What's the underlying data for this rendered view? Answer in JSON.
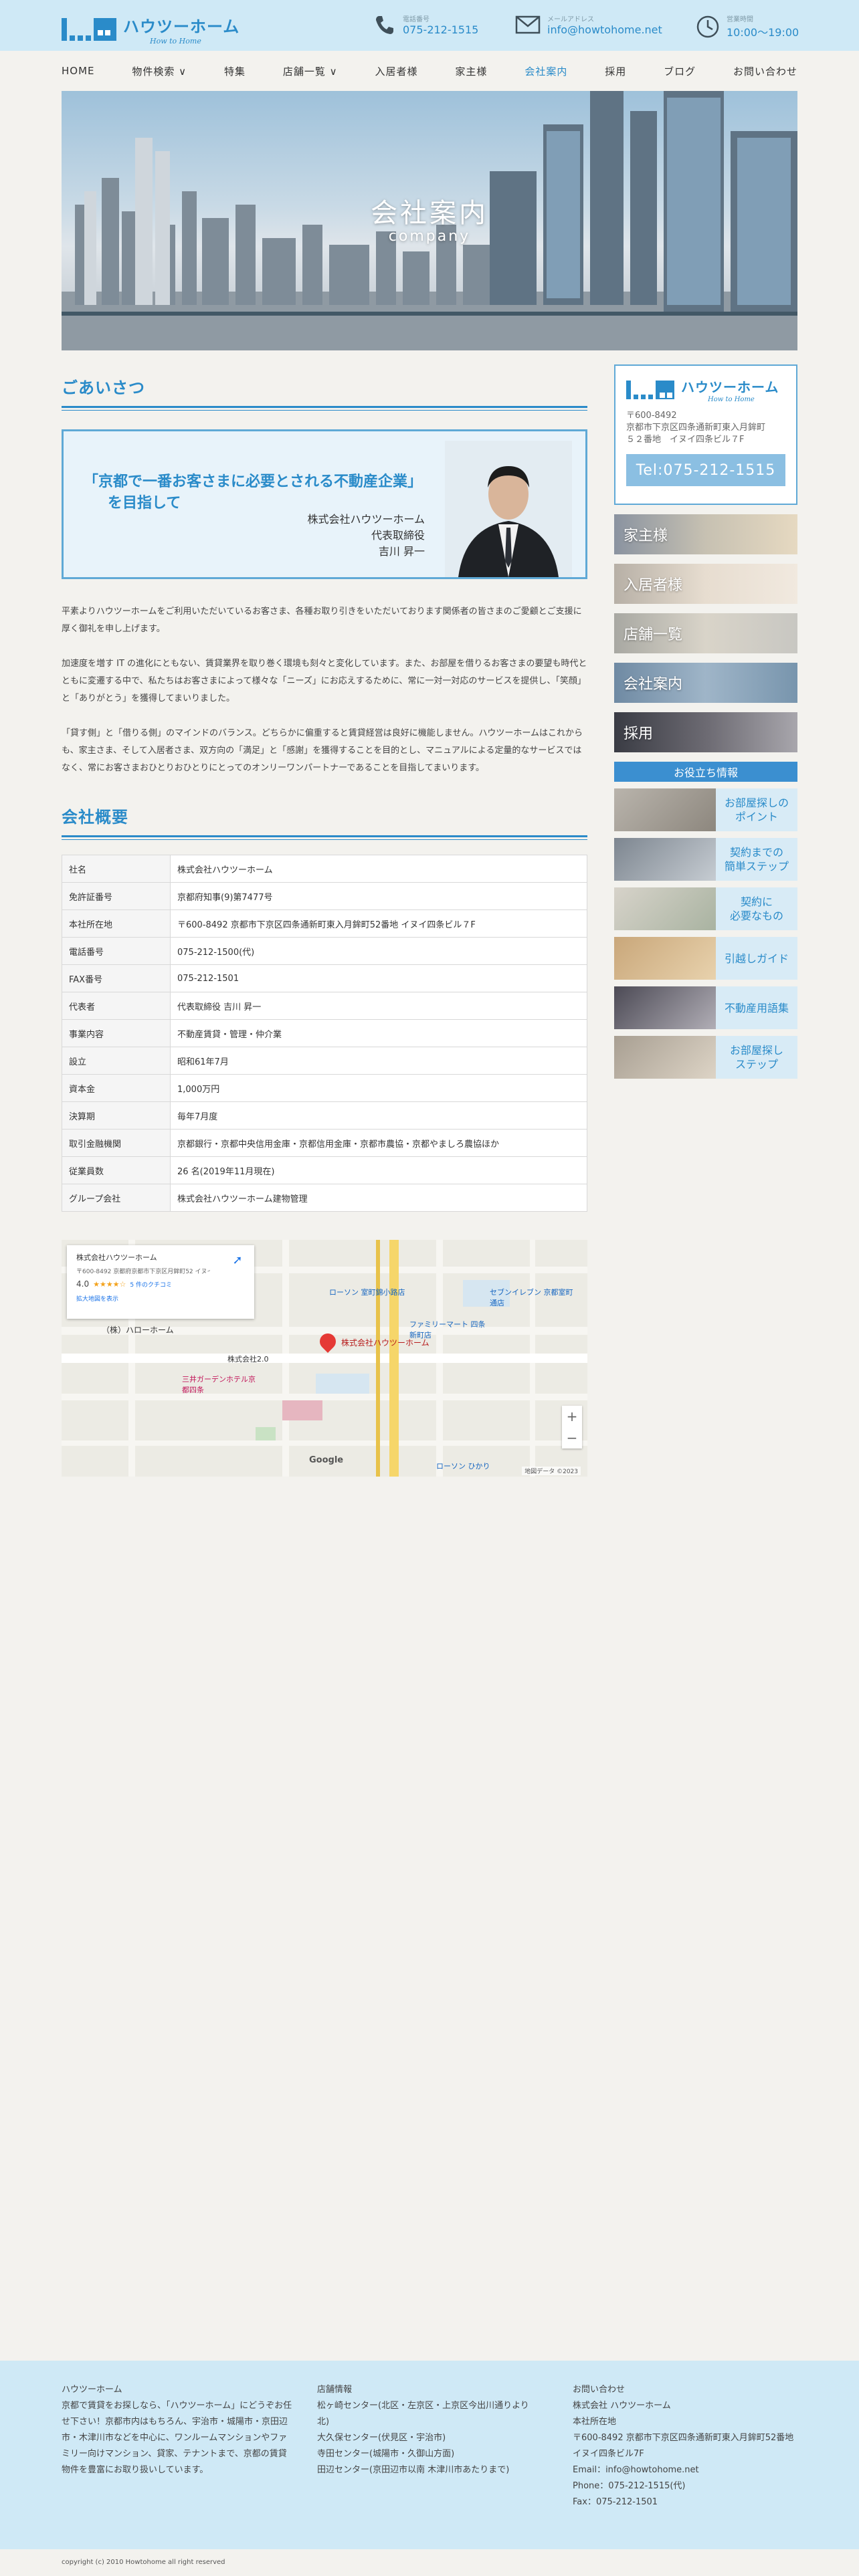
{
  "header": {
    "logo_jp": "ハウツーホーム",
    "logo_en": "How to Home",
    "phone_label": "電話番号",
    "phone": "075-212-1515",
    "mail_label": "メールアドレス",
    "mail": "info@howtohome.net",
    "hours_label": "営業時間",
    "hours": "10:00～19:00"
  },
  "nav": {
    "items": [
      {
        "label": "HOME"
      },
      {
        "label": "物件検索 ∨"
      },
      {
        "label": "特集"
      },
      {
        "label": "店舗一覧 ∨"
      },
      {
        "label": "入居者様"
      },
      {
        "label": "家主様"
      },
      {
        "label": "会社案内"
      },
      {
        "label": "採用"
      },
      {
        "label": "ブログ"
      },
      {
        "label": "お問い合わせ"
      }
    ]
  },
  "hero": {
    "title": "会社案内",
    "subtitle": "company"
  },
  "greeting": {
    "heading": "ごあいさつ",
    "catch_line1": "「京都で一番お客さまに必要とされる不動産企業」",
    "catch_line2": "を目指して",
    "sign_company": "株式会社ハウツーホーム",
    "sign_title": "代表取締役",
    "sign_name": "吉川 昇一",
    "para1": "平素よりハウツーホームをご利用いただいているお客さま、各種お取り引きをいただいております関係者の皆さまのご愛顧とご支援に厚く御礼を申し上げます。",
    "para2": "加速度を増す IT の進化にともない、賃貸業界を取り巻く環境も刻々と変化しています。また、お部屋を借りるお客さまの要望も時代とともに変遷する中で、私たちはお客さまによって様々な「ニーズ」にお応えするために、常に一対一対応のサービスを提供し、「笑顔」と「ありがとう」を獲得してまいりました。",
    "para3": "「貸す側」と「借りる側」のマインドのバランス。どちらかに偏重すると賃貸経営は良好に機能しません。ハウツーホームはこれからも、家主さま、そして入居者さま、双方向の「満足」と「感謝」を獲得することを目的とし、マニュアルによる定量的なサービスではなく、常にお客さまおひとりおひとりにとってのオンリーワンパートナーであることを目指してまいります。"
  },
  "overview": {
    "heading": "会社概要",
    "rows": [
      {
        "k": "社名",
        "v": "株式会社ハウツーホーム"
      },
      {
        "k": "免許証番号",
        "v": "京都府知事(9)第7477号"
      },
      {
        "k": "本社所在地",
        "v": "〒600-8492 京都市下京区四条通新町東入月鉾町52番地 イヌイ四条ビル７F"
      },
      {
        "k": "電話番号",
        "v": "075-212-1500(代)"
      },
      {
        "k": "FAX番号",
        "v": "075-212-1501"
      },
      {
        "k": "代表者",
        "v": "代表取締役 吉川 昇一"
      },
      {
        "k": "事業内容",
        "v": "不動産賃貸・管理・仲介業"
      },
      {
        "k": "設立",
        "v": "昭和61年7月"
      },
      {
        "k": "資本金",
        "v": "1,000万円"
      },
      {
        "k": "決算期",
        "v": "毎年7月度"
      },
      {
        "k": "取引金融機関",
        "v": "京都銀行・京都中央信用金庫・京都信用金庫・京都市農協・京都やましろ農協ほか"
      },
      {
        "k": "従業員数",
        "v": "26 名(2019年11月現在)"
      },
      {
        "k": "グループ会社",
        "v": "株式会社ハウツーホーム建物管理"
      }
    ]
  },
  "map": {
    "popup_title": "株式会社ハウツーホーム",
    "popup_addr": "〒600-8492 京都府京都市下京区月鉾町52 イヌイ四条ビル 7F",
    "rating": "4.0",
    "stars": "★★★★☆",
    "reviews": "5 件のクチコミ",
    "larger": "拡大地図を表示",
    "pin_label": "株式会社ハウツーホーム",
    "labels": [
      {
        "text": "（株）ハローホーム"
      },
      {
        "text": "株式会社2.0"
      },
      {
        "text": "ローソン 室町錦小路店"
      },
      {
        "text": "ファミリーマート 四条新町店"
      },
      {
        "text": "セブンイレブン 京都室町通店"
      },
      {
        "text": "三井ガーデンホテル京都四条"
      },
      {
        "text": "ローソン ひかり"
      }
    ],
    "copyright": "地図データ ©2023",
    "zoom_in": "+",
    "zoom_out": "−",
    "google": "Google"
  },
  "sidebar": {
    "addr1": "〒600-8492",
    "addr2": "京都市下京区四条通新町東入月鉾町",
    "addr3": "５２番地　イヌイ四条ビル７F",
    "tel": "Tel:075-212-1515",
    "banners": [
      {
        "label": "家主様"
      },
      {
        "label": "入居者様"
      },
      {
        "label": "店舗一覧"
      },
      {
        "label": "会社案内"
      },
      {
        "label": "採用"
      }
    ],
    "help_heading": "お役立ち情報",
    "guides": [
      {
        "l1": "お部屋探しの",
        "l2": "ポイント"
      },
      {
        "l1": "契約までの",
        "l2": "簡単ステップ"
      },
      {
        "l1": "契約に",
        "l2": "必要なもの"
      },
      {
        "l1": "引越しガイド",
        "l2": ""
      },
      {
        "l1": "不動産用語集",
        "l2": ""
      },
      {
        "l1": "お部屋探し",
        "l2": "ステップ"
      }
    ]
  },
  "footer": {
    "col1_title": "ハウツーホーム",
    "col1_text": "京都で賃貸をお探しなら、「ハウツーホーム」にどうぞお任せ下さい！京都市内はもちろん、宇治市・城陽市・京田辺市・木津川市などを中心に、ワンルームマンションやファミリー向けマンション、貸家、テナントまで、京都の賃貸物件を豊富にお取り扱いしています。",
    "col2_title": "店舗情報",
    "col2_l1": "松ヶ崎センター(北区・左京区・上京区今出川通りより北)",
    "col2_l2": "大久保センター(伏見区・宇治市)",
    "col2_l3": "寺田センター(城陽市・久御山方面)",
    "col2_l4": "田辺センター(京田辺市以南 木津川市あたりまで)",
    "col3_title": "お問い合わせ",
    "col3_l1": "株式会社 ハウツーホーム",
    "col3_l2": "本社所在地",
    "col3_l3": "〒600-8492 京都市下京区四条通新町東入月鉾町52番地 イヌイ四条ビル7F",
    "col3_l4": "Email：info@howtohome.net",
    "col3_l5": "Phone：075-212-1515(代)",
    "col3_l6": "Fax：075-212-1501",
    "copyright": "copyright (c) 2010 Howtohome all right reserved"
  }
}
